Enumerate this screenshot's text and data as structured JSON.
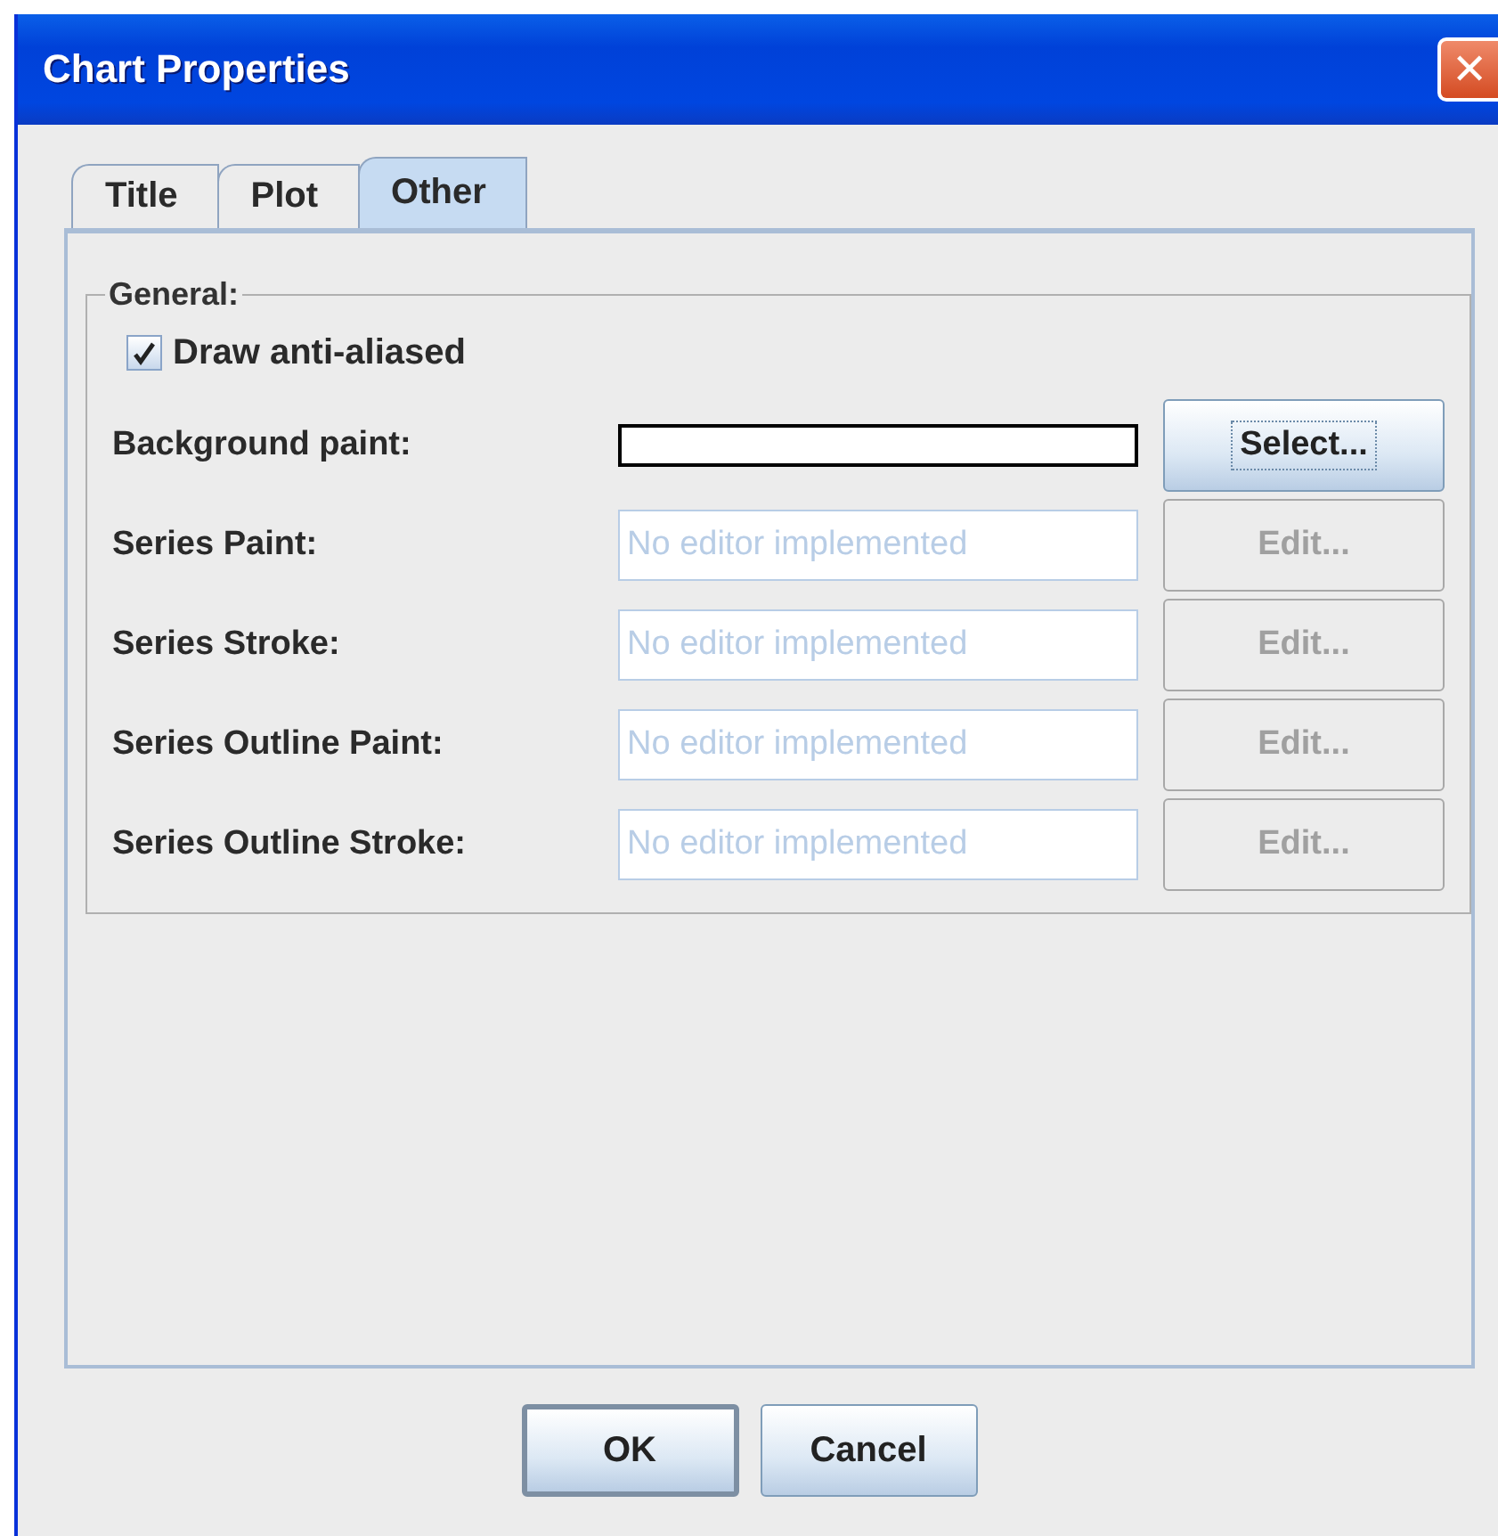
{
  "window": {
    "title": "Chart Properties",
    "close": "✕"
  },
  "tabs": [
    {
      "label": "Title",
      "selected": false
    },
    {
      "label": "Plot",
      "selected": false
    },
    {
      "label": "Other",
      "selected": true
    }
  ],
  "group": {
    "title": "General:",
    "checkbox": {
      "label": "Draw anti-aliased",
      "checked": true
    },
    "rows": [
      {
        "kind": "swatch",
        "label": "Background paint:",
        "button": {
          "label": "Select...",
          "disabled": false,
          "focused": true
        }
      },
      {
        "kind": "text",
        "label": "Series Paint:",
        "value": "No editor implemented",
        "disabled": true,
        "button": {
          "label": "Edit...",
          "disabled": true,
          "focused": false
        }
      },
      {
        "kind": "text",
        "label": "Series Stroke:",
        "value": "No editor implemented",
        "disabled": true,
        "button": {
          "label": "Edit...",
          "disabled": true,
          "focused": false
        }
      },
      {
        "kind": "text",
        "label": "Series Outline Paint:",
        "value": "No editor implemented",
        "disabled": true,
        "button": {
          "label": "Edit...",
          "disabled": true,
          "focused": false
        }
      },
      {
        "kind": "text",
        "label": "Series Outline Stroke:",
        "value": "No editor implemented",
        "disabled": true,
        "button": {
          "label": "Edit...",
          "disabled": true,
          "focused": false
        }
      }
    ]
  },
  "buttons": [
    {
      "label": "OK",
      "default": true
    },
    {
      "label": "Cancel",
      "default": false
    }
  ]
}
